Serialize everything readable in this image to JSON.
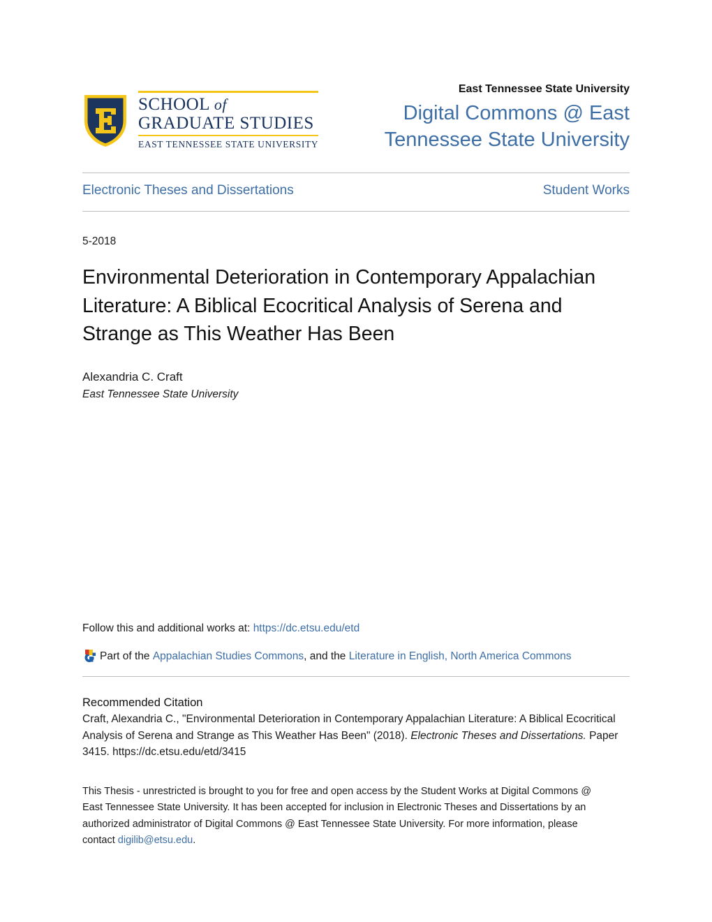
{
  "header": {
    "logo": {
      "shield_alt": "ETSU shield with letter E",
      "wordmark_line1_a": "SCHOOL",
      "wordmark_line1_b": "of",
      "wordmark_line2": "GRADUATE STUDIES",
      "wordmark_sub": "EAST TENNESSEE STATE UNIVERSITY",
      "navy": "#16305c",
      "gold": "#f5c518"
    },
    "university": "East Tennessee State University",
    "repository_title": "Digital Commons @ East Tennessee State University"
  },
  "nav": {
    "left_label": "Electronic Theses and Dissertations",
    "right_label": "Student Works"
  },
  "record": {
    "date": "5-2018",
    "title": "Environmental Deterioration in Contemporary Appalachian Literature: A Biblical Ecocritical Analysis of Serena and Strange as This Weather Has Been",
    "author": "Alexandria C. Craft",
    "affiliation": "East Tennessee State University"
  },
  "follow": {
    "prefix": "Follow this and additional works at:",
    "url": "https://dc.etsu.edu/etd",
    "part_of": "Part of the",
    "commons_1": "Appalachian Studies Commons",
    "separator": ", and the",
    "commons_2": "Literature in English, North America Commons",
    "icon_name": "digital-commons-network-icon"
  },
  "citation": {
    "heading": "Recommended Citation",
    "text_1": "Craft, Alexandria C., \"Environmental Deterioration in Contemporary Appalachian Literature: A Biblical Ecocritical Analysis of Serena and Strange as This Weather Has Been\" (2018). ",
    "italic_1": "Electronic Theses and Dissertations.",
    "text_2": " Paper 3415. https://dc.etsu.edu/etd/3415"
  },
  "footer": {
    "text_1": "This Thesis - unrestricted is brought to you for free and open access by the Student Works at Digital Commons @ East Tennessee State University. It has been accepted for inclusion in Electronic Theses and Dissertations by an authorized administrator of Digital Commons @ East Tennessee State University. For more information, please contact ",
    "email": "digilib@etsu.edu",
    "text_2": "."
  },
  "colors": {
    "link_blue": "#3d6ea5",
    "rule_gray": "#bdbdbd",
    "text_black": "#1a1a1a"
  }
}
